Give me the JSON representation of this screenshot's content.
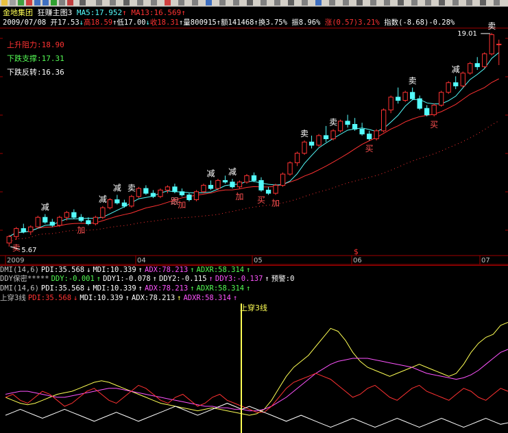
{
  "header": {
    "stock_name": "金地集团",
    "chart_name": "狂赚主图3",
    "ma5": "MA5:17.952",
    "ma13": "MA13:16.569",
    "date": "2009/07/08",
    "open": "开17.53",
    "high": "高18.59",
    "low": "低17.00",
    "close": "收18.31",
    "volume": "量800915",
    "amount": "额141468",
    "turnover": "换3.75%",
    "amplitude": "振8.96%",
    "change": "涨(0.57)3.21%",
    "index": "指数(-8.68)-0.28%"
  },
  "levels": {
    "resistance": "上升阻力:18.90",
    "support": "下跌支撑:17.31",
    "reversal": "下跌反转:16.36"
  },
  "colors": {
    "up": "#ff3232",
    "down": "#54fcfc",
    "ma5": "#54fcfc",
    "ma13": "#ff3232",
    "pdi": "#ff3232",
    "mdi": "#ffffff",
    "adx": "#ff54ff",
    "adxr": "#ffff54"
  },
  "chart_data": {
    "type": "candlestick",
    "price_min": 5.67,
    "price_max": 19.01,
    "low_label": "5.67",
    "high_label": "19.01",
    "x_labels": [
      "2009",
      "04",
      "05",
      "06",
      "07"
    ],
    "candles": [
      [
        5.9,
        6.4,
        5.67,
        6.3
      ],
      [
        6.3,
        6.9,
        6.1,
        6.8
      ],
      [
        6.8,
        7.1,
        6.5,
        6.6
      ],
      [
        6.6,
        7.0,
        6.4,
        6.9
      ],
      [
        6.9,
        7.6,
        6.8,
        7.5
      ],
      [
        7.5,
        7.7,
        7.1,
        7.2
      ],
      [
        7.2,
        7.4,
        6.9,
        7.0
      ],
      [
        7.0,
        7.6,
        6.9,
        7.5
      ],
      [
        7.5,
        7.9,
        7.3,
        7.8
      ],
      [
        7.8,
        8.0,
        7.4,
        7.5
      ],
      [
        7.5,
        7.7,
        7.2,
        7.3
      ],
      [
        7.3,
        7.5,
        7.0,
        7.1
      ],
      [
        7.1,
        7.6,
        7.0,
        7.5
      ],
      [
        7.5,
        8.2,
        7.4,
        8.1
      ],
      [
        8.1,
        8.7,
        8.0,
        8.6
      ],
      [
        8.6,
        8.9,
        8.3,
        8.4
      ],
      [
        8.4,
        8.6,
        8.1,
        8.2
      ],
      [
        8.2,
        8.9,
        8.1,
        8.8
      ],
      [
        8.8,
        9.4,
        8.7,
        9.3
      ],
      [
        9.3,
        9.5,
        8.9,
        9.0
      ],
      [
        9.0,
        9.2,
        8.7,
        8.8
      ],
      [
        8.8,
        9.3,
        8.7,
        9.2
      ],
      [
        9.2,
        9.5,
        9.0,
        9.4
      ],
      [
        9.4,
        9.6,
        9.0,
        9.1
      ],
      [
        9.1,
        9.3,
        8.8,
        8.9
      ],
      [
        8.9,
        9.0,
        8.5,
        8.6
      ],
      [
        8.6,
        9.2,
        8.5,
        9.1
      ],
      [
        9.1,
        9.6,
        9.0,
        9.5
      ],
      [
        9.5,
        9.8,
        9.2,
        9.3
      ],
      [
        9.3,
        9.9,
        9.2,
        9.8
      ],
      [
        9.8,
        10.1,
        9.6,
        9.7
      ],
      [
        9.7,
        9.9,
        9.3,
        9.4
      ],
      [
        9.4,
        9.8,
        9.3,
        9.7
      ],
      [
        9.7,
        10.2,
        9.6,
        10.1
      ],
      [
        10.1,
        10.3,
        9.7,
        9.8
      ],
      [
        9.8,
        10.0,
        9.1,
        9.2
      ],
      [
        9.2,
        9.4,
        8.9,
        9.0
      ],
      [
        9.0,
        9.6,
        8.9,
        9.5
      ],
      [
        9.5,
        10.3,
        9.4,
        10.2
      ],
      [
        10.2,
        11.0,
        10.1,
        10.9
      ],
      [
        10.9,
        11.6,
        10.7,
        11.5
      ],
      [
        11.5,
        12.3,
        11.4,
        12.2
      ],
      [
        12.2,
        12.6,
        11.8,
        12.0
      ],
      [
        12.0,
        12.7,
        11.9,
        12.6
      ],
      [
        12.6,
        13.2,
        12.2,
        12.4
      ],
      [
        12.4,
        13.0,
        12.3,
        12.9
      ],
      [
        12.9,
        13.6,
        12.8,
        13.5
      ],
      [
        13.5,
        13.9,
        13.1,
        13.3
      ],
      [
        13.3,
        13.7,
        12.9,
        13.0
      ],
      [
        13.0,
        13.4,
        12.6,
        12.7
      ],
      [
        12.7,
        12.9,
        12.3,
        12.4
      ],
      [
        12.4,
        13.0,
        12.3,
        12.9
      ],
      [
        12.9,
        14.3,
        12.8,
        14.2
      ],
      [
        14.2,
        15.1,
        14.0,
        15.0
      ],
      [
        15.0,
        15.6,
        14.6,
        14.8
      ],
      [
        14.8,
        15.4,
        14.7,
        15.3
      ],
      [
        15.3,
        15.6,
        14.8,
        14.9
      ],
      [
        14.9,
        15.1,
        14.2,
        14.3
      ],
      [
        14.3,
        14.5,
        13.8,
        13.9
      ],
      [
        13.9,
        14.6,
        13.8,
        14.5
      ],
      [
        14.5,
        15.4,
        14.4,
        15.3
      ],
      [
        15.3,
        16.0,
        15.2,
        15.9
      ],
      [
        15.9,
        16.3,
        15.5,
        15.7
      ],
      [
        15.7,
        16.6,
        15.6,
        16.5
      ],
      [
        16.5,
        17.2,
        16.4,
        17.1
      ],
      [
        17.1,
        17.5,
        16.7,
        16.9
      ],
      [
        16.9,
        17.8,
        16.8,
        17.7
      ],
      [
        17.7,
        19.01,
        17.6,
        18.9
      ],
      [
        18.3,
        18.59,
        17.0,
        18.31
      ]
    ],
    "signals": [
      {
        "text": "卖",
        "i": 1,
        "pos": "below"
      },
      {
        "text": "减",
        "i": 5,
        "pos": "above"
      },
      {
        "text": "加",
        "i": 10,
        "pos": "below"
      },
      {
        "text": "减",
        "i": 13,
        "pos": "above"
      },
      {
        "text": "减",
        "i": 15,
        "pos": "above"
      },
      {
        "text": "卖",
        "i": 17,
        "pos": "above"
      },
      {
        "text": "跟",
        "i": 23,
        "pos": "below"
      },
      {
        "text": "加",
        "i": 24,
        "pos": "below"
      },
      {
        "text": "减",
        "i": 28,
        "pos": "above"
      },
      {
        "text": "减",
        "i": 31,
        "pos": "above"
      },
      {
        "text": "加",
        "i": 32,
        "pos": "below"
      },
      {
        "text": "买",
        "i": 35,
        "pos": "below"
      },
      {
        "text": "加",
        "i": 37,
        "pos": "below"
      },
      {
        "text": "卖",
        "i": 41,
        "pos": "above"
      },
      {
        "text": "卖",
        "i": 45,
        "pos": "above"
      },
      {
        "text": "买",
        "i": 50,
        "pos": "below"
      },
      {
        "text": "卖",
        "i": 56,
        "pos": "above"
      },
      {
        "text": "买",
        "i": 59,
        "pos": "below"
      },
      {
        "text": "减",
        "i": 62,
        "pos": "above"
      },
      {
        "text": "卖",
        "i": 67,
        "pos": "above"
      }
    ],
    "special_marker": "$",
    "dmi_crossover_label": "上穿3线",
    "dmi": {
      "pdi": [
        22,
        24,
        20,
        18,
        22,
        26,
        24,
        20,
        16,
        18,
        22,
        26,
        28,
        24,
        20,
        18,
        22,
        26,
        30,
        28,
        24,
        20,
        18,
        22,
        24,
        20,
        16,
        18,
        22,
        24,
        20,
        18,
        16,
        14,
        12,
        12,
        16,
        22,
        28,
        32,
        34,
        36,
        38,
        36,
        34,
        30,
        26,
        22,
        24,
        28,
        30,
        26,
        22,
        20,
        24,
        28,
        30,
        26,
        24,
        22,
        20,
        24,
        28,
        26,
        22,
        20,
        24,
        28,
        26
      ],
      "mdi": [
        10,
        12,
        14,
        12,
        10,
        8,
        10,
        12,
        14,
        12,
        10,
        8,
        6,
        8,
        10,
        12,
        10,
        8,
        6,
        8,
        10,
        12,
        14,
        16,
        14,
        12,
        10,
        12,
        14,
        16,
        18,
        16,
        14,
        16,
        14,
        12,
        10,
        8,
        6,
        8,
        10,
        8,
        6,
        4,
        2,
        4,
        6,
        8,
        6,
        4,
        2,
        4,
        6,
        8,
        6,
        4,
        2,
        4,
        6,
        8,
        6,
        4,
        2,
        4,
        6,
        8,
        6,
        4,
        5
      ],
      "adx": [
        24,
        25,
        26,
        26,
        25,
        24,
        23,
        22,
        22,
        23,
        24,
        25,
        26,
        27,
        28,
        28,
        27,
        26,
        25,
        24,
        23,
        22,
        21,
        20,
        19,
        18,
        17,
        16,
        16,
        15,
        15,
        14,
        14,
        13,
        13,
        14,
        16,
        19,
        22,
        26,
        30,
        34,
        38,
        41,
        44,
        46,
        47,
        48,
        48,
        48,
        47,
        46,
        45,
        44,
        43,
        42,
        40,
        38,
        37,
        36,
        35,
        34,
        35,
        37,
        40,
        44,
        48,
        52,
        54
      ],
      "adxr": [
        22,
        20,
        18,
        17,
        18,
        20,
        22,
        24,
        25,
        26,
        28,
        30,
        32,
        33,
        32,
        30,
        28,
        26,
        24,
        22,
        20,
        18,
        17,
        16,
        15,
        14,
        13,
        14,
        15,
        14,
        13,
        12,
        11,
        10,
        11,
        14,
        20,
        28,
        36,
        42,
        46,
        50,
        56,
        62,
        68,
        66,
        60,
        52,
        46,
        42,
        40,
        38,
        36,
        38,
        40,
        42,
        44,
        42,
        40,
        38,
        36,
        38,
        44,
        52,
        58,
        62,
        64,
        70,
        72
      ]
    }
  },
  "indicators": {
    "row1": {
      "name": "DMI(14,6)",
      "pdi": "PDI:35.568",
      "mdi": "MDI:10.339",
      "adx": "ADX:78.213",
      "adxr": "ADXR:58.314"
    },
    "row2": {
      "name": "DDY保密*****",
      "ddy": "DDY:-0.001",
      "ddy1": "DDY1:-0.078",
      "ddy2": "DDY2:-0.115",
      "ddy3": "DDY3:-0.137",
      "alert": "预警:0"
    },
    "row3": {
      "name": "DMI(14,6)",
      "pdi": "PDI:35.568",
      "mdi": "MDI:10.339",
      "adx": "ADX:78.213",
      "adxr": "ADXR:58.314"
    },
    "row4": {
      "name": "上穿3线",
      "pdi": "PDI:35.568",
      "mdi": "MDI:10.339",
      "adx": "ADX:78.213",
      "adxr": "ADXR:58.314"
    }
  }
}
